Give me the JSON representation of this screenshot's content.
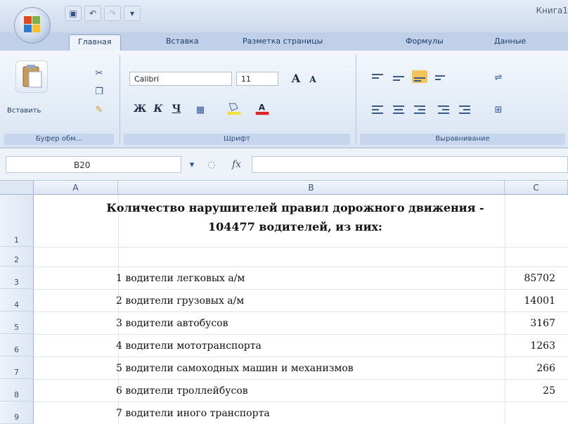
{
  "titlebar": {
    "window_title": "Книга1",
    "qat": [
      "save-icon",
      "undo-icon",
      "redo-icon",
      "customize-icon"
    ]
  },
  "tabs": [
    "Главная",
    "Вставка",
    "Разметка страницы",
    "Формулы",
    "Данные"
  ],
  "ribbon": {
    "clipboard": {
      "paste_label": "Вставить",
      "group_label": "Буфер обм..."
    },
    "font": {
      "font_name": "Calibri",
      "font_size": "11",
      "grow_font": "A",
      "shrink_font": "A",
      "bold": "Ж",
      "italic": "К",
      "underline": "Ч",
      "group_label": "Шрифт"
    },
    "alignment": {
      "group_label": "Выравнивание"
    }
  },
  "formula_bar": {
    "name_box": "B20",
    "fx": "fx",
    "value": ""
  },
  "sheet": {
    "columns": [
      "A",
      "B",
      "C"
    ],
    "rows": [
      "1",
      "2",
      "3",
      "4",
      "5",
      "6",
      "7",
      "8",
      "9"
    ],
    "title_line1": "Количество нарушителей правил дорожного движения -",
    "title_line2": "104477 водителей, из них:",
    "items": [
      {
        "text": "1 водители легковых а/м",
        "value": "85702"
      },
      {
        "text": "2 водители грузовых а/м",
        "value": "14001"
      },
      {
        "text": "3 водители автобусов",
        "value": "3167"
      },
      {
        "text": "4 водители мототранспорта",
        "value": "1263"
      },
      {
        "text": "5 водители самоходных машин и механизмов",
        "value": "266"
      },
      {
        "text": "6 водители троллейбусов",
        "value": "25"
      },
      {
        "text": "7 водители иного транспорта",
        "value": ""
      }
    ]
  },
  "colors": {
    "ribbon_bg": "#dfe8f5",
    "header_bg": "#dde6f2",
    "font_color_red": "#e02020",
    "highlight_yellow": "#f5e03a"
  }
}
